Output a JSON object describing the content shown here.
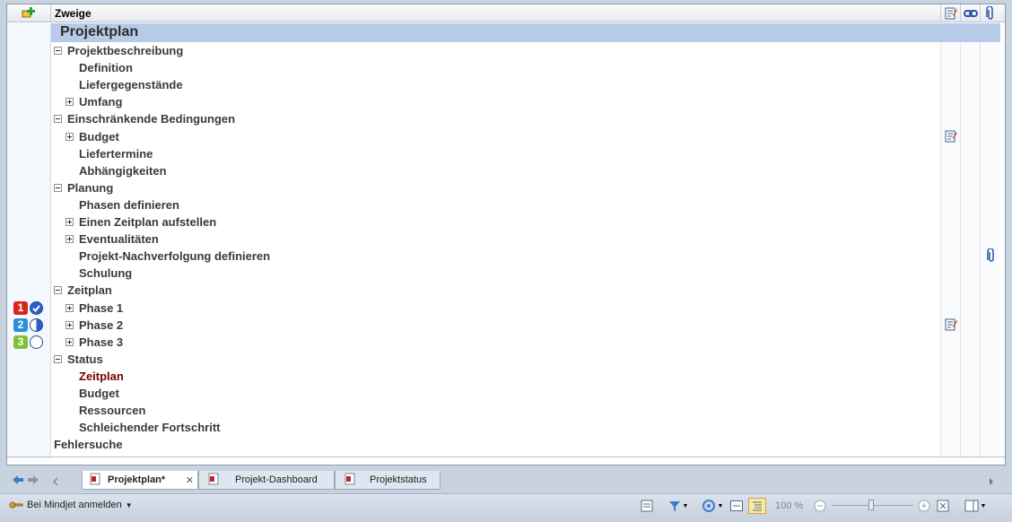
{
  "header": {
    "title": "Zweige"
  },
  "map": {
    "title": "Projektplan",
    "rows": [
      {
        "label": "Projektbeschreibung",
        "toggle": "minus",
        "level": 1
      },
      {
        "label": "Definition",
        "toggle": "",
        "level": 2
      },
      {
        "label": "Liefergegenstände",
        "toggle": "",
        "level": 2
      },
      {
        "label": "Umfang",
        "toggle": "plus",
        "level": 2
      },
      {
        "label": "Einschränkende Bedingungen",
        "toggle": "minus",
        "level": 1
      },
      {
        "label": "Budget",
        "toggle": "plus",
        "level": 2,
        "note": true
      },
      {
        "label": "Liefertermine",
        "toggle": "",
        "level": 2
      },
      {
        "label": "Abhängigkeiten",
        "toggle": "",
        "level": 2
      },
      {
        "label": "Planung",
        "toggle": "minus",
        "level": 1
      },
      {
        "label": "Phasen definieren",
        "toggle": "",
        "level": 2
      },
      {
        "label": "Einen Zeitplan aufstellen",
        "toggle": "plus",
        "level": 2
      },
      {
        "label": "Eventualitäten",
        "toggle": "plus",
        "level": 2
      },
      {
        "label": "Projekt-Nachverfolgung definieren",
        "toggle": "",
        "level": 2,
        "attachment": true
      },
      {
        "label": "Schulung",
        "toggle": "",
        "level": 2
      },
      {
        "label": "Zeitplan",
        "toggle": "minus",
        "level": 1
      },
      {
        "label": "Phase 1",
        "toggle": "plus",
        "level": 2,
        "priority": "1",
        "progress": "complete"
      },
      {
        "label": "Phase 2",
        "toggle": "plus",
        "level": 2,
        "priority": "2",
        "progress": "half",
        "note": true
      },
      {
        "label": "Phase 3",
        "toggle": "plus",
        "level": 2,
        "priority": "3",
        "progress": "none"
      },
      {
        "label": "Status",
        "toggle": "minus",
        "level": 1
      },
      {
        "label": "Zeitplan",
        "toggle": "",
        "level": 2,
        "selected": true
      },
      {
        "label": "Budget",
        "toggle": "",
        "level": 2
      },
      {
        "label": "Ressourcen",
        "toggle": "",
        "level": 2
      },
      {
        "label": "Schleichender Fortschritt",
        "toggle": "",
        "level": 2
      },
      {
        "label": "Fehlersuche",
        "toggle": "",
        "level": 1
      }
    ]
  },
  "tabs": [
    {
      "label": "Projektplan*",
      "active": true
    },
    {
      "label": "Projekt-Dashboard",
      "active": false
    },
    {
      "label": "Projektstatus",
      "active": false
    }
  ],
  "statusbar": {
    "login_label": "Bei Mindjet anmelden",
    "zoom_label": "100 %"
  },
  "colors": {
    "priority_1": "#d8261c",
    "priority_2": "#2a8fd6",
    "priority_3": "#7fbf3a",
    "title_row_bg": "#b7cbe8",
    "selected_text": "#7a0000"
  },
  "icons": {
    "add_topic": "add-topic-icon",
    "notes": "notes-icon",
    "links": "link-icon",
    "attachments": "paperclip-icon"
  }
}
